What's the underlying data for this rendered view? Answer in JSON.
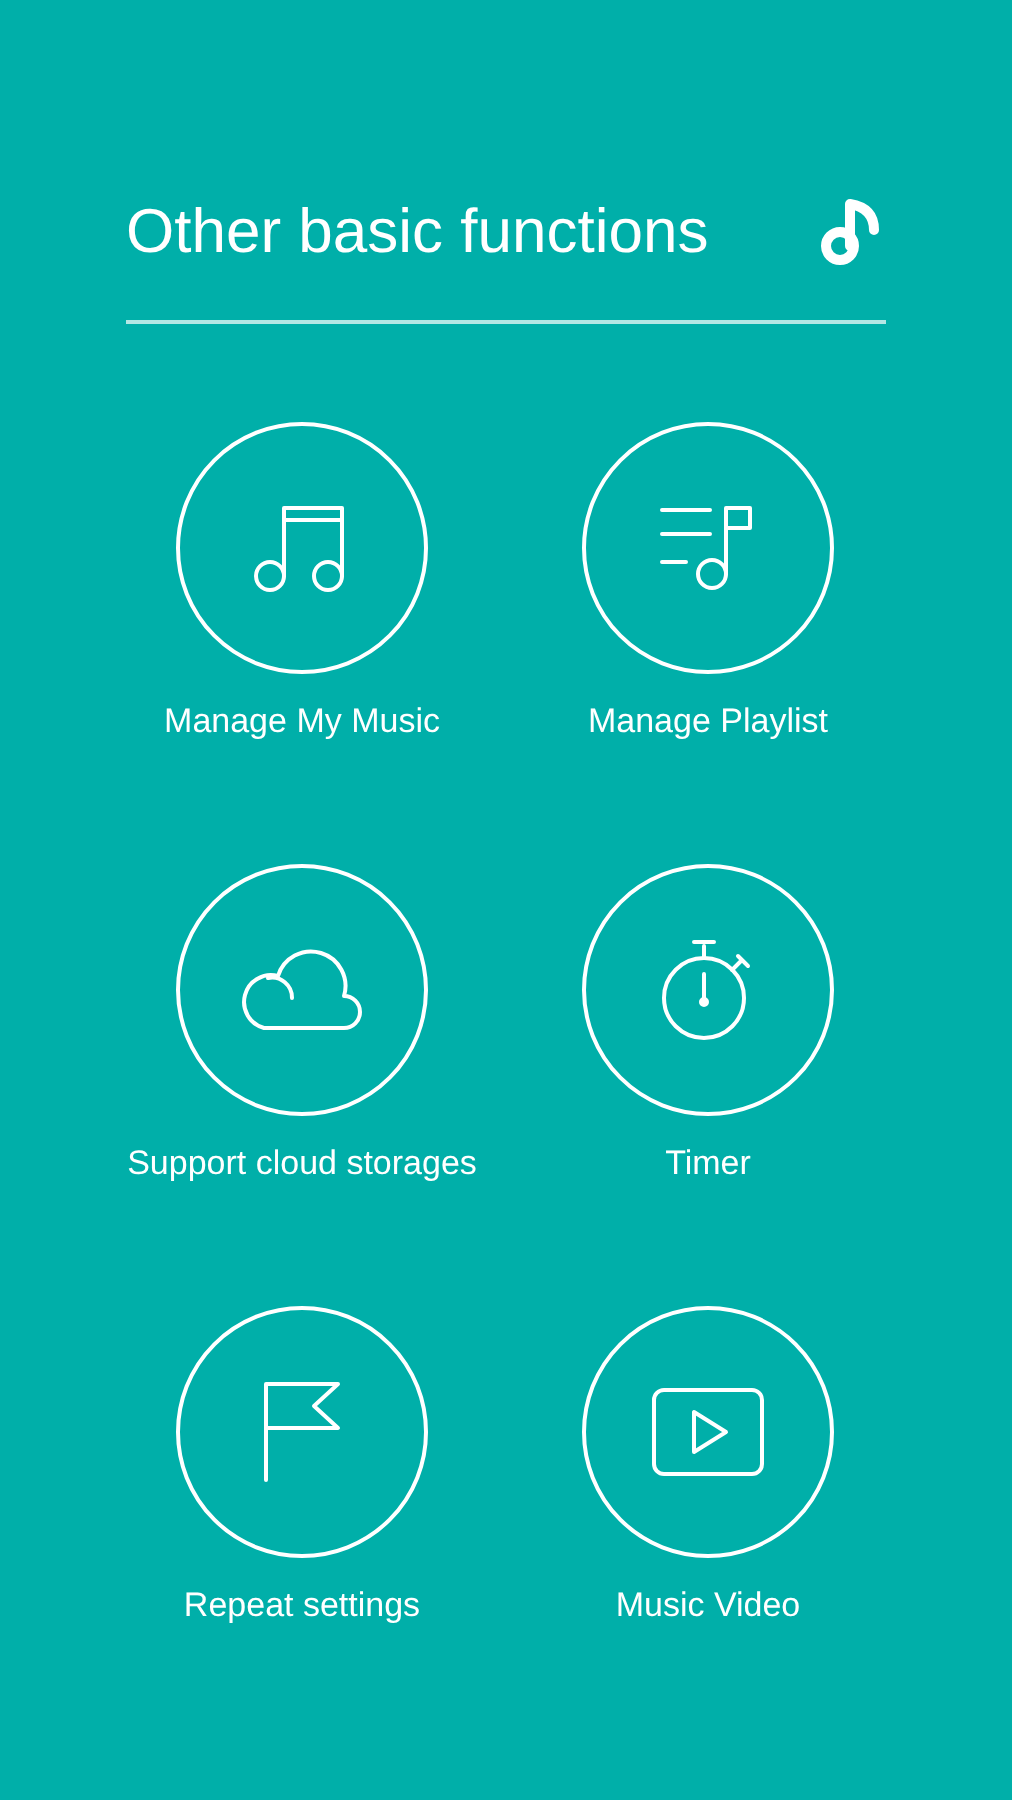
{
  "header": {
    "title": "Other basic functions"
  },
  "functions": [
    {
      "label": "Manage My Music"
    },
    {
      "label": "Manage Playlist"
    },
    {
      "label": "Support cloud storages"
    },
    {
      "label": "Timer"
    },
    {
      "label": "Repeat settings"
    },
    {
      "label": "Music Video"
    }
  ]
}
